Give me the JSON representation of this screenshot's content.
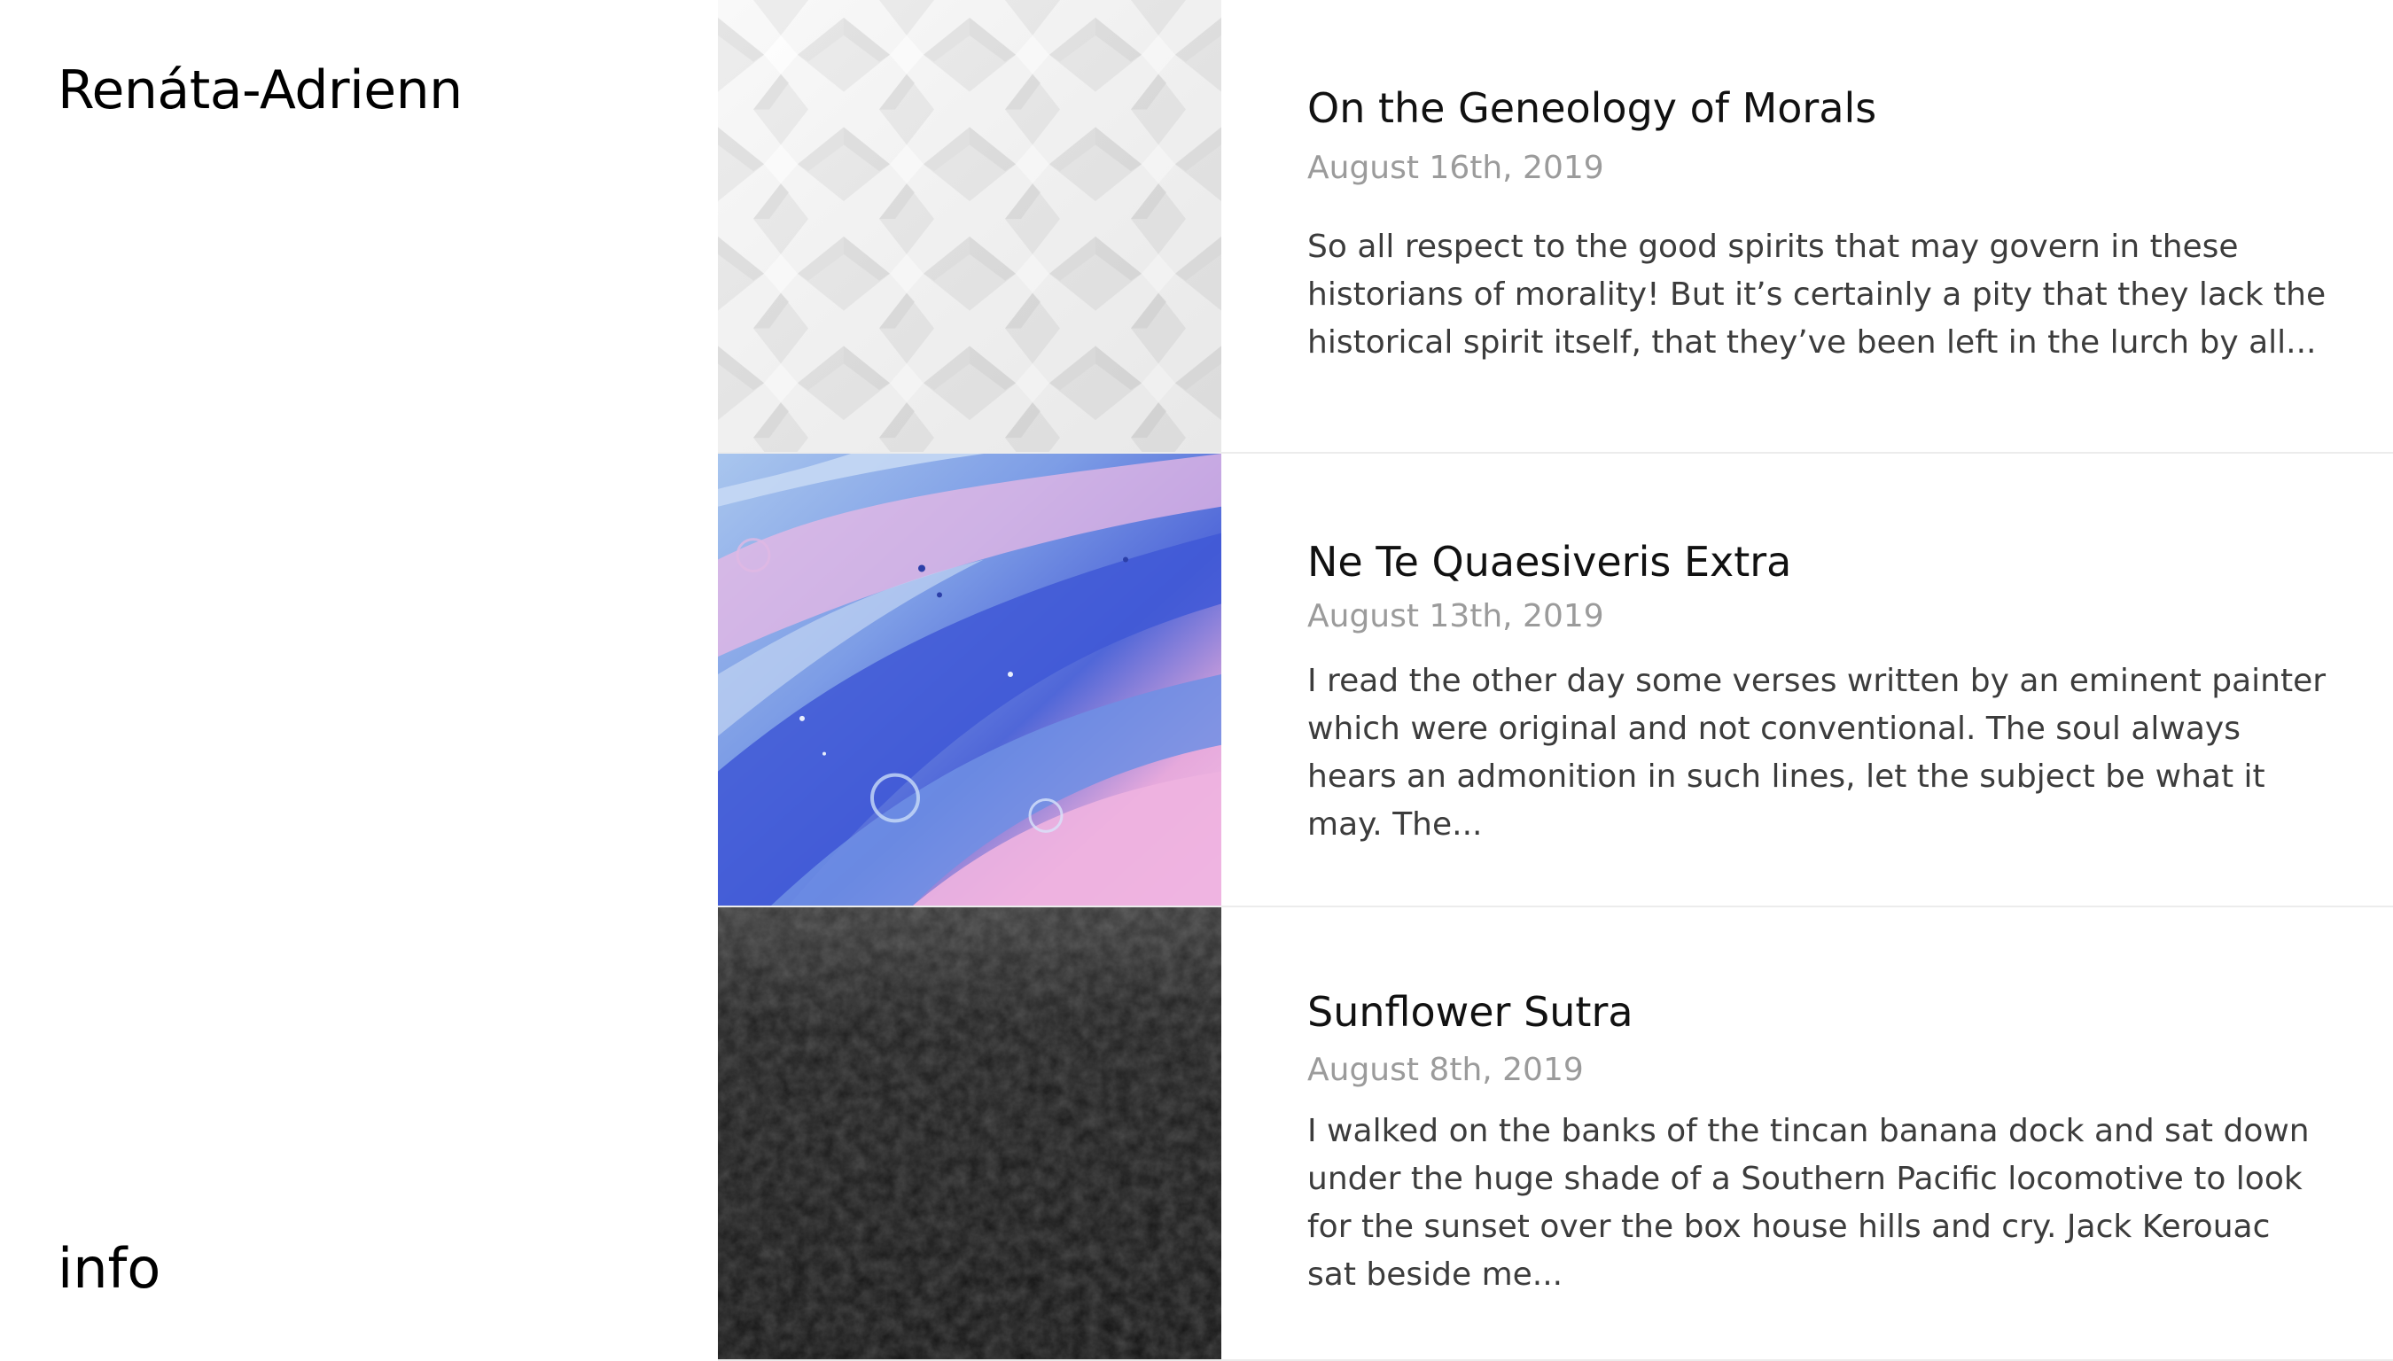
{
  "site": {
    "title": "Renáta-Adrienn",
    "info_label": "info"
  },
  "posts": [
    {
      "title": "On the Geneology of Morals",
      "date": "August 16th, 2019",
      "excerpt": "So all respect to the good spirits that may govern in these historians of morality! But it’s certainly a pity that they lack the historical spirit itself, that they’ve been left in the lurch by all...",
      "image": "white-woven-pattern"
    },
    {
      "title": "Ne Te Quaesiveris Extra",
      "date": "August 13th, 2019",
      "excerpt": "I read the other day some verses written by an eminent painter which were original and not conventional. The soul always hears an admonition in such lines, let the subject be what it may. The...",
      "image": "blue-pink-fluid-paint"
    },
    {
      "title": "Sunflower Sutra",
      "date": "August 8th, 2019",
      "excerpt": "I walked on the banks of the tincan banana dock and sat down under the huge shade of a Southern Pacific locomotive to look for the sunset over the box house hills and cry. Jack Kerouac sat beside me...",
      "image": "black-leather-texture"
    }
  ]
}
